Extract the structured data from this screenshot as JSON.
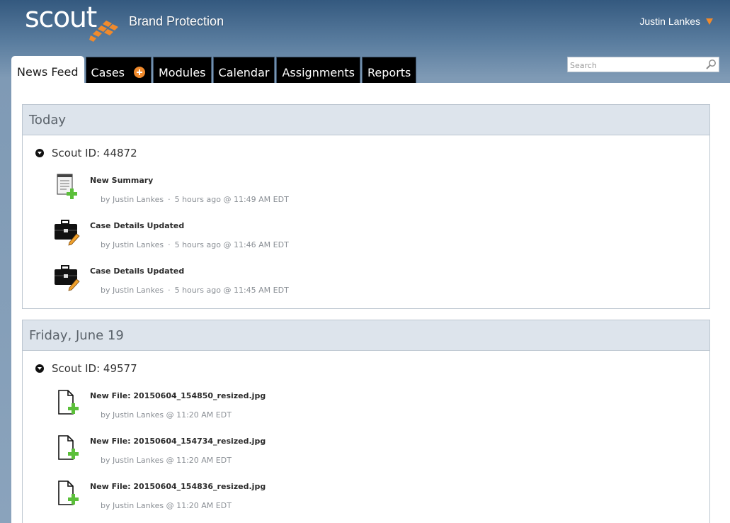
{
  "header": {
    "logo_text": "scout",
    "app_name": "Brand Protection",
    "user_name": "Justin Lankes",
    "accent_color": "#f08a2c"
  },
  "tabs": [
    {
      "label": "News Feed",
      "active": true
    },
    {
      "label": "Cases",
      "has_add_icon": true
    },
    {
      "label": "Modules"
    },
    {
      "label": "Calendar"
    },
    {
      "label": "Assignments"
    },
    {
      "label": "Reports"
    }
  ],
  "search": {
    "placeholder": "Search",
    "value": ""
  },
  "feed": [
    {
      "date": "Today",
      "case": "Scout ID: 44872",
      "entries": [
        {
          "icon": "summary-add-icon",
          "title": "New Summary",
          "author": "by Justin Lankes",
          "relative": "5 hours ago @ 11:49 AM EDT"
        },
        {
          "icon": "briefcase-edit-icon",
          "title": "Case Details Updated",
          "author": "by Justin Lankes",
          "relative": "5 hours ago @ 11:46 AM EDT"
        },
        {
          "icon": "briefcase-edit-icon",
          "title": "Case Details Updated",
          "author": "by Justin Lankes",
          "relative": "5 hours ago @ 11:45 AM EDT"
        }
      ]
    },
    {
      "date": "Friday, June 19",
      "case": "Scout ID: 49577",
      "entries": [
        {
          "icon": "file-add-icon",
          "title": "New File: 20150604_154850_resized.jpg",
          "meta": "by Justin Lankes @ 11:20 AM EDT"
        },
        {
          "icon": "file-add-icon",
          "title": "New File: 20150604_154734_resized.jpg",
          "meta": "by Justin Lankes @ 11:20 AM EDT"
        },
        {
          "icon": "file-add-icon",
          "title": "New File: 20150604_154836_resized.jpg",
          "meta": "by Justin Lankes @ 11:20 AM EDT"
        }
      ]
    }
  ]
}
